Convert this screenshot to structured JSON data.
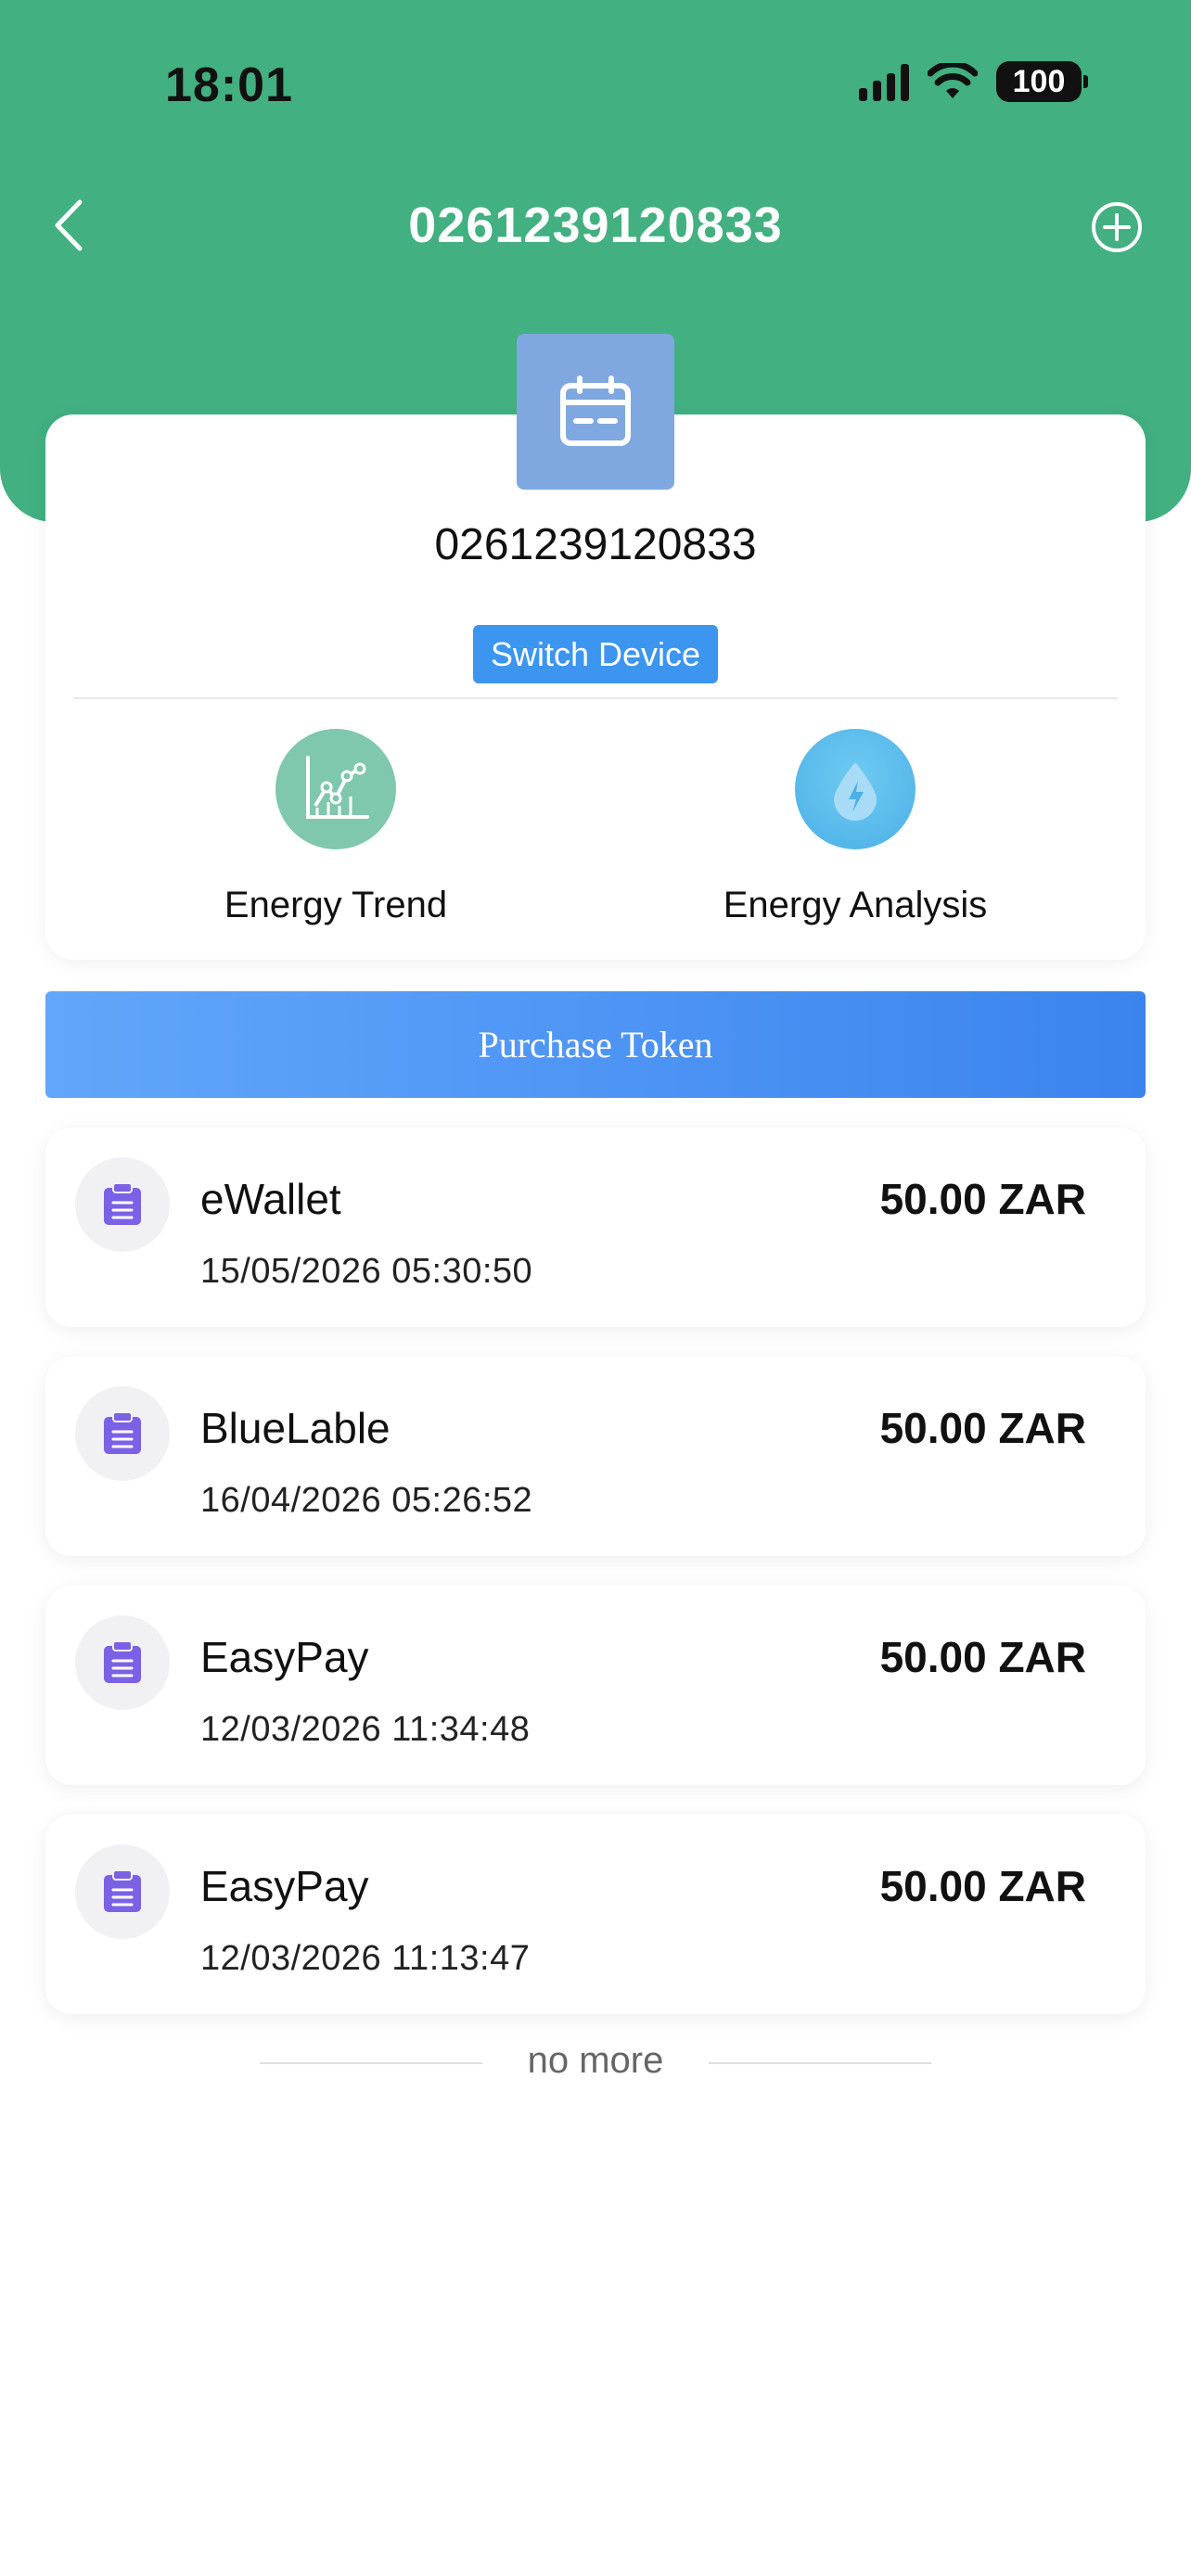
{
  "status_bar": {
    "time": "18:01",
    "battery": "100"
  },
  "nav": {
    "title": "0261239120833"
  },
  "device": {
    "number": "0261239120833",
    "switch_label": "Switch Device"
  },
  "features": [
    {
      "label": "Energy Trend",
      "icon": "line-chart-icon"
    },
    {
      "label": "Energy Analysis",
      "icon": "energy-drop-icon"
    }
  ],
  "purchase_label": "Purchase Token",
  "transactions": [
    {
      "method": "eWallet",
      "datetime": "15/05/2026 05:30:50",
      "amount": "50.00 ZAR"
    },
    {
      "method": "BlueLable",
      "datetime": "16/04/2026 05:26:52",
      "amount": "50.00 ZAR"
    },
    {
      "method": "EasyPay",
      "datetime": "12/03/2026 11:34:48",
      "amount": "50.00 ZAR"
    },
    {
      "method": "EasyPay",
      "datetime": "12/03/2026 11:13:47",
      "amount": "50.00 ZAR"
    }
  ],
  "footer": {
    "no_more": "no more"
  },
  "colors": {
    "header_green": "#42b080",
    "accent_blue": "#3c95ef",
    "device_icon_bg": "#7fa8e0",
    "receipt_purple": "#7b61e6"
  }
}
